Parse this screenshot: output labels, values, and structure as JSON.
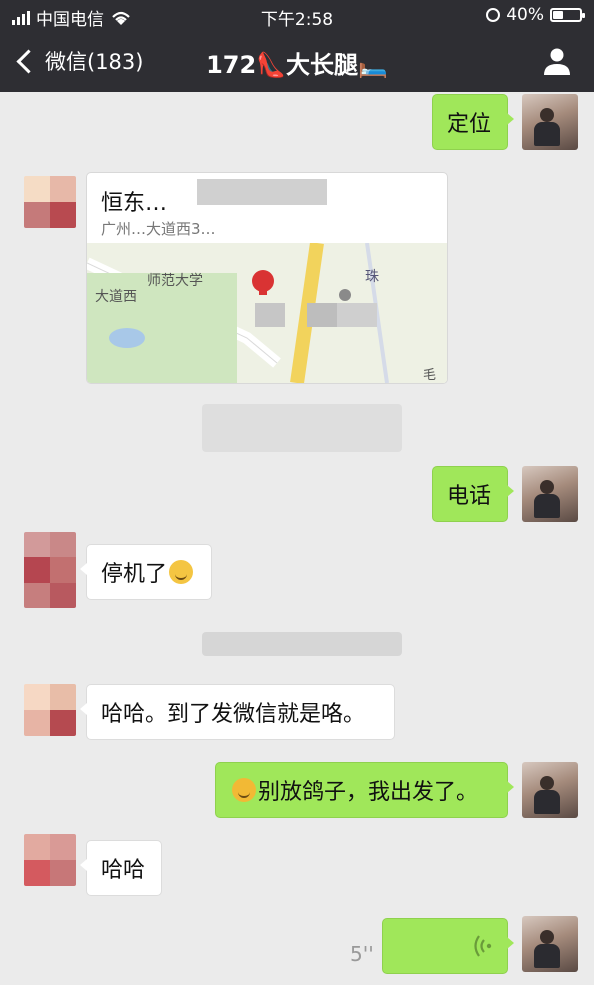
{
  "status_bar": {
    "carrier": "中国电信",
    "time": "下午2:58",
    "battery": "40%"
  },
  "navbar": {
    "back_label": "微信(183)",
    "title": "172👠大长腿🛏️",
    "profile_icon": "person-icon"
  },
  "messages": {
    "m1": "定位",
    "location": {
      "title": "恒东…",
      "subtitle": "广州…大道西3…",
      "map_labels": [
        "大道西",
        "师范大学",
        "珠",
        "毛"
      ]
    },
    "m2": "电话",
    "m3": "停机了",
    "m4": "哈哈。到了发微信就是咯。",
    "m5": "别放鸽子，我出发了。",
    "m6": "哈哈",
    "voice_duration": "5''"
  },
  "colors": {
    "navbar_bg": "#2e2e33",
    "chat_bg": "#ebebeb",
    "self_bubble": "#a0e75a",
    "other_bubble": "#ffffff"
  }
}
